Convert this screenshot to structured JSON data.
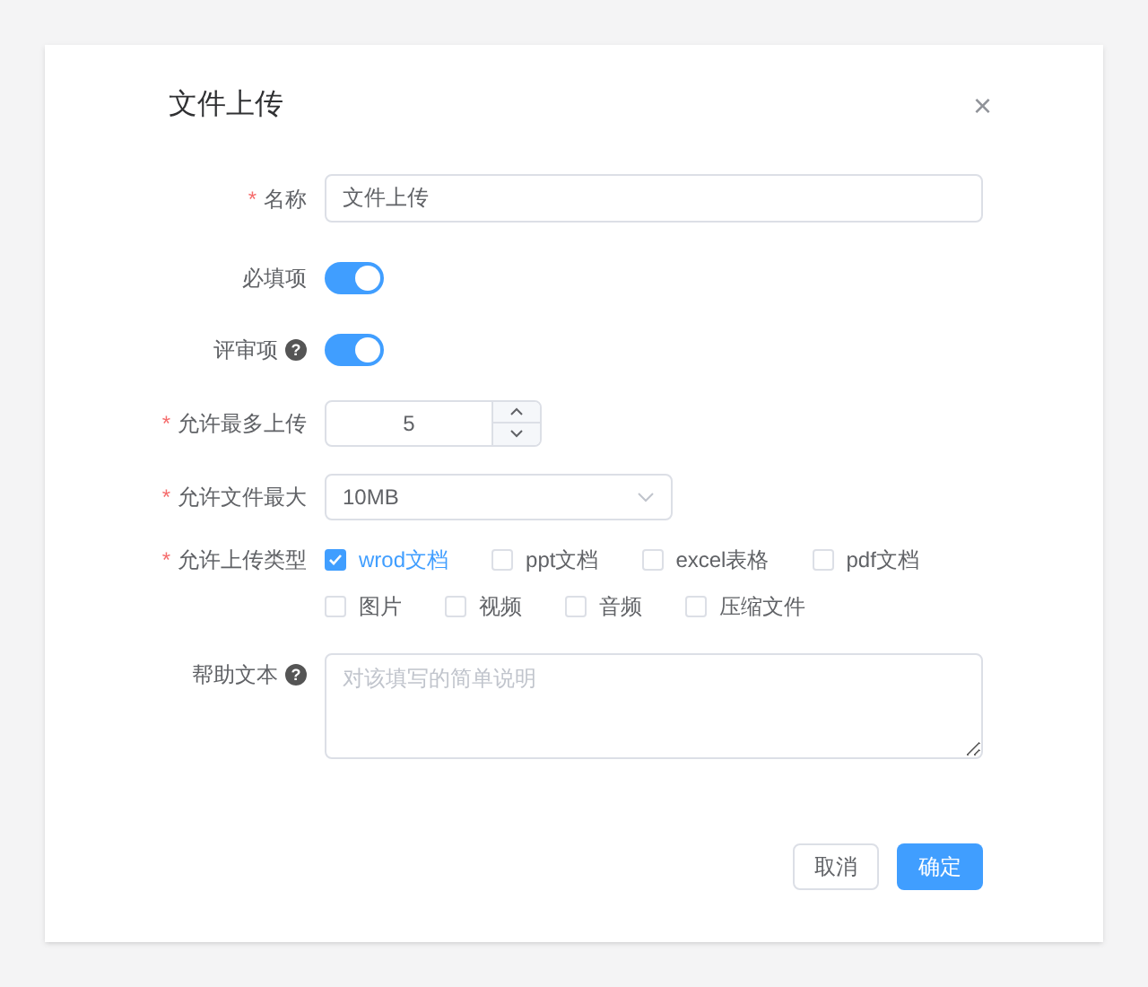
{
  "dialog": {
    "title": "文件上传",
    "close": "×"
  },
  "name_field": {
    "label": "名称",
    "required_mark": "*",
    "value": "文件上传"
  },
  "required_switch": {
    "label": "必填项",
    "on": true
  },
  "review_switch": {
    "label": "评审项",
    "on": true,
    "help": "?"
  },
  "max_uploads": {
    "label": "允许最多上传",
    "required_mark": "*",
    "value": "5"
  },
  "max_size": {
    "label": "允许文件最大",
    "required_mark": "*",
    "value": "10MB"
  },
  "file_types": {
    "label": "允许上传类型",
    "required_mark": "*",
    "options": [
      {
        "label": "wrod文档",
        "checked": true
      },
      {
        "label": "ppt文档",
        "checked": false
      },
      {
        "label": "excel表格",
        "checked": false
      },
      {
        "label": "pdf文档",
        "checked": false
      },
      {
        "label": "图片",
        "checked": false
      },
      {
        "label": "视频",
        "checked": false
      },
      {
        "label": "音频",
        "checked": false
      },
      {
        "label": "压缩文件",
        "checked": false
      }
    ]
  },
  "help_text": {
    "label": "帮助文本",
    "help": "?",
    "placeholder": "对该填写的简单说明"
  },
  "buttons": [
    {
      "label": "取消",
      "kind": "secondary"
    },
    {
      "label": "确定",
      "kind": "primary"
    }
  ]
}
